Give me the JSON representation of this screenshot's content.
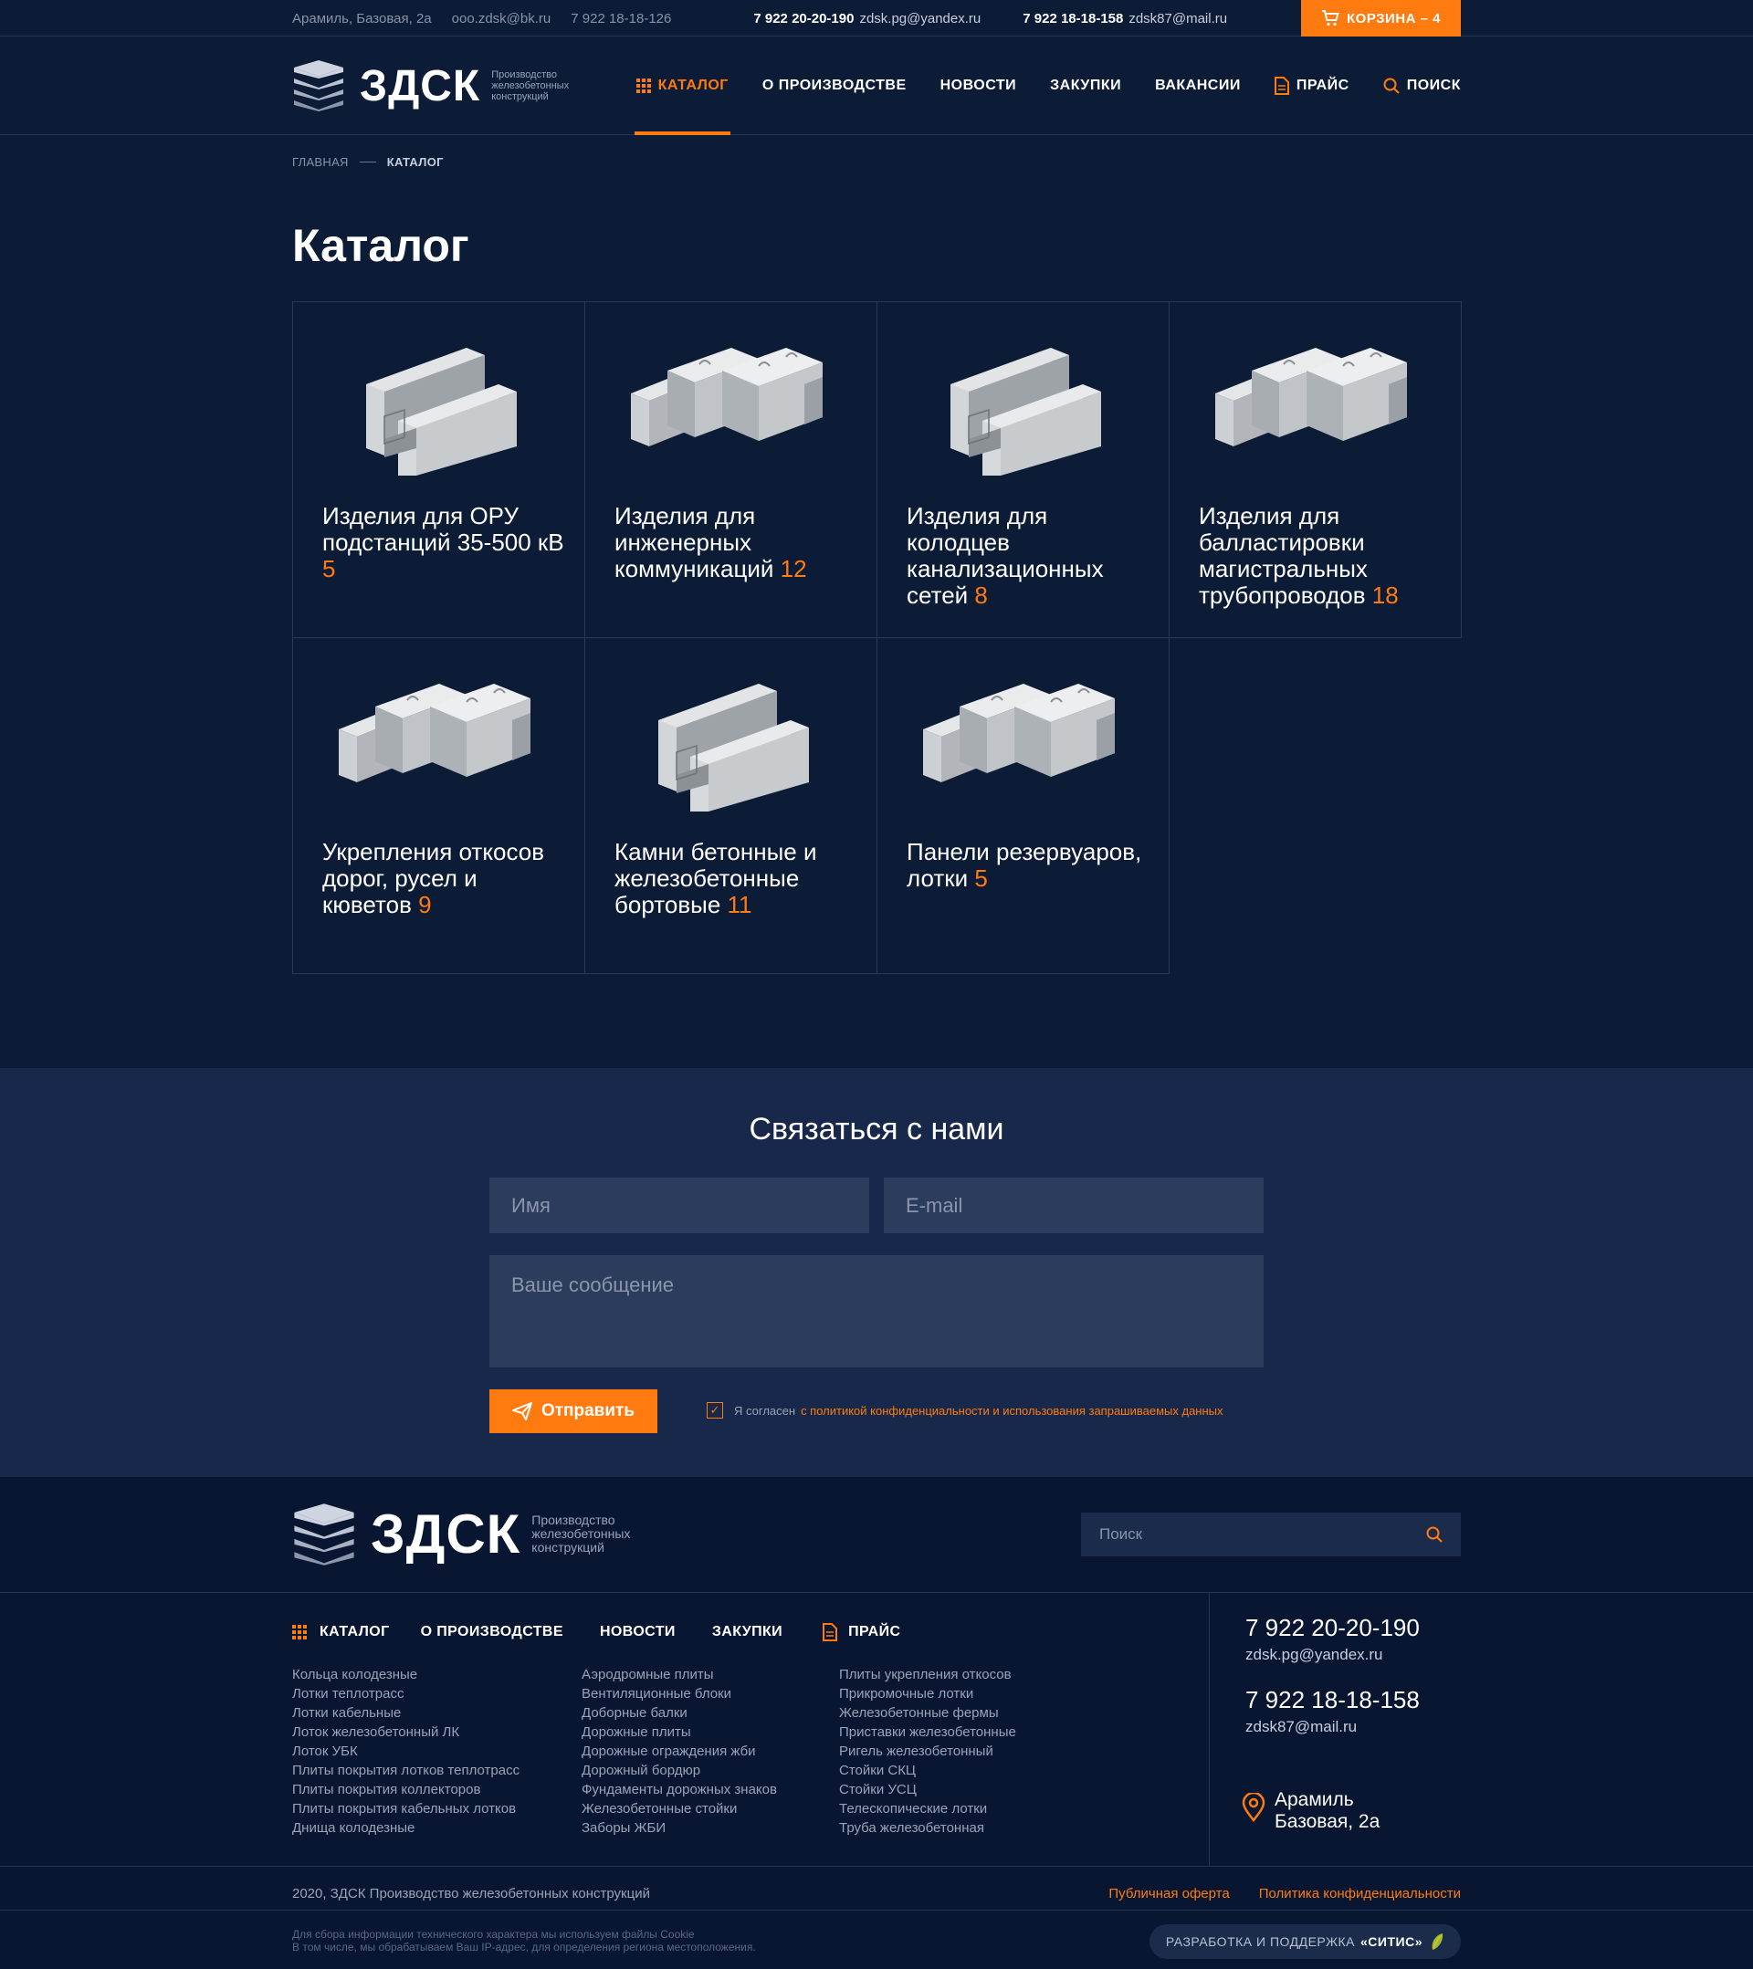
{
  "topbar": {
    "address": "Арамиль, Базовая, 2а",
    "email1": "ooo.zdsk@bk.ru",
    "phone1": "7 922 18-18-126",
    "phone2": "7 922 20-20-190",
    "email2": "zdsk.pg@yandex.ru",
    "phone3": "7 922 18-18-158",
    "email3": "zdsk87@mail.ru",
    "cart_label": "КОРЗИНА – 4"
  },
  "header": {
    "logo_word": "ЗДСК",
    "logo_sub": "Производство железобетонных конструкций",
    "nav": {
      "catalog": "КАТАЛОГ",
      "production": "О ПРОИЗВОДСТВЕ",
      "news": "НОВОСТИ",
      "purchases": "ЗАКУПКИ",
      "vacancies": "ВАКАНСИИ",
      "price": "ПРАЙС",
      "search": "ПОИСК"
    }
  },
  "breadcrumb": {
    "home": "ГЛАВНАЯ",
    "current": "КАТАЛОГ"
  },
  "page_title": "Каталог",
  "catalog": [
    {
      "name": "Изделия для ОРУ подстанций 35-500 кВ",
      "count": "5",
      "image": "trough"
    },
    {
      "name": "Изделия для инженерных коммуникаций",
      "count": "12",
      "image": "blocks"
    },
    {
      "name": "Изделия для колодцев канализационных сетей",
      "count": "8",
      "image": "trough"
    },
    {
      "name": "Изделия для балластировки магистральных трубопроводов",
      "count": "18",
      "image": "blocks"
    },
    {
      "name": "Укрепления откосов дорог, русел и кюветов",
      "count": "9",
      "image": "blocks"
    },
    {
      "name": "Камни бетонные и железобетонные бортовые",
      "count": "11",
      "image": "trough"
    },
    {
      "name": "Панели резервуаров, лотки",
      "count": "5",
      "image": "blocks"
    }
  ],
  "contact": {
    "title": "Связаться с нами",
    "name_placeholder": "Имя",
    "email_placeholder": "E-mail",
    "message_placeholder": "Ваше сообщение",
    "send_label": "Отправить",
    "agree_text": "Я согласен",
    "agree_link": "с политикой конфиденциальности и использования запрашиваемых данных"
  },
  "footer": {
    "logo_word": "ЗДСК",
    "logo_sub": "Производство железобетонных конструкций",
    "search_placeholder": "Поиск",
    "nav": {
      "catalog": "КАТАЛОГ",
      "production": "О ПРОИЗВОДСТВЕ",
      "news": "НОВОСТИ",
      "purchases": "ЗАКУПКИ",
      "price": "ПРАЙС"
    },
    "col1": [
      "Кольца колодезные",
      "Лотки теплотрасс",
      "Лотки кабельные",
      "Лоток железобетонный ЛК",
      "Лоток УБК",
      "Плиты покрытия лотков теплотрасс",
      "Плиты покрытия коллекторов",
      "Плиты покрытия кабельных лотков",
      "Днища колодезные"
    ],
    "col2": [
      "Аэродромные плиты",
      "Вентиляционные блоки",
      "Доборные балки",
      "Дорожные плиты",
      "Дорожные ограждения жби",
      "Дорожный бордюр",
      "Фундаменты дорожных знаков",
      "Железобетонные стойки",
      "Заборы ЖБИ"
    ],
    "col3": [
      "Плиты укрепления откосов",
      "Прикромочные лотки",
      "Железобетонные фермы",
      "Приставки железобетонные",
      "Ригель железобетонный",
      "Стойки СКЦ",
      "Стойки УСЦ",
      "Телескопические лотки",
      "Труба железобетонная"
    ],
    "phone1": "7 922 20-20-190",
    "email1": "zdsk.pg@yandex.ru",
    "phone2": "7 922 18-18-158",
    "email2": "zdsk87@mail.ru",
    "address_city": "Арамиль",
    "address_street": "Базовая, 2а",
    "copyright": "2020, ЗДСК Производство железобетонных конструкций",
    "offer_link": "Публичная оферта",
    "privacy_link": "Политика конфиденциальности",
    "cookie_line1": "Для сбора информации технического характера мы используем файлы Cookie",
    "cookie_line2": "В том числе, мы обрабатываем Ваш IP-адрес, для определения региона местоположения.",
    "dev_label": "РАЗРАБОТКА И ПОДДЕРЖКА",
    "dev_name": "«СИТИС»"
  },
  "colors": {
    "accent": "#ff7b0f",
    "background": "#0c1b36",
    "contact_bg": "#17284a",
    "footer_bg": "#081631"
  }
}
